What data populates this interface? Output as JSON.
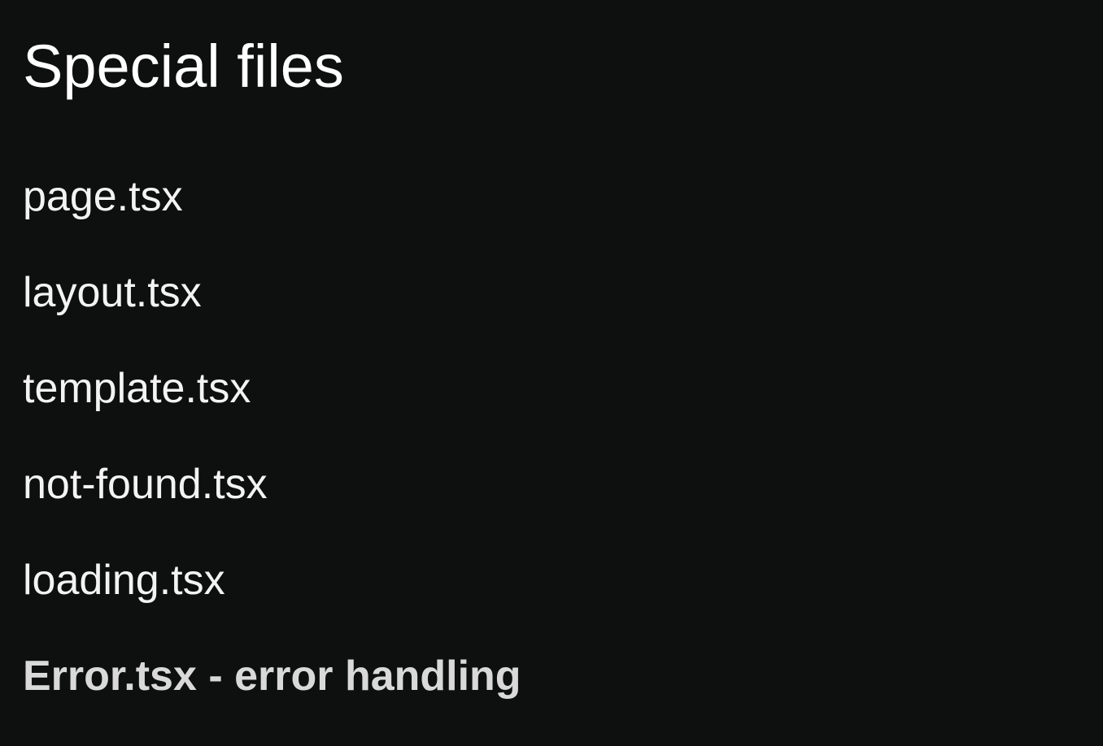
{
  "slide": {
    "title": "Special files",
    "items": [
      {
        "label": "page.tsx"
      },
      {
        "label": "layout.tsx"
      },
      {
        "label": "template.tsx"
      },
      {
        "label": "not-found.tsx"
      },
      {
        "label": "loading.tsx"
      },
      {
        "label": "Error.tsx - error handling"
      }
    ]
  },
  "colors": {
    "background": "#0e0f0f",
    "text": "#f3f3f3",
    "emphasis_text": "#d9d9d9"
  }
}
